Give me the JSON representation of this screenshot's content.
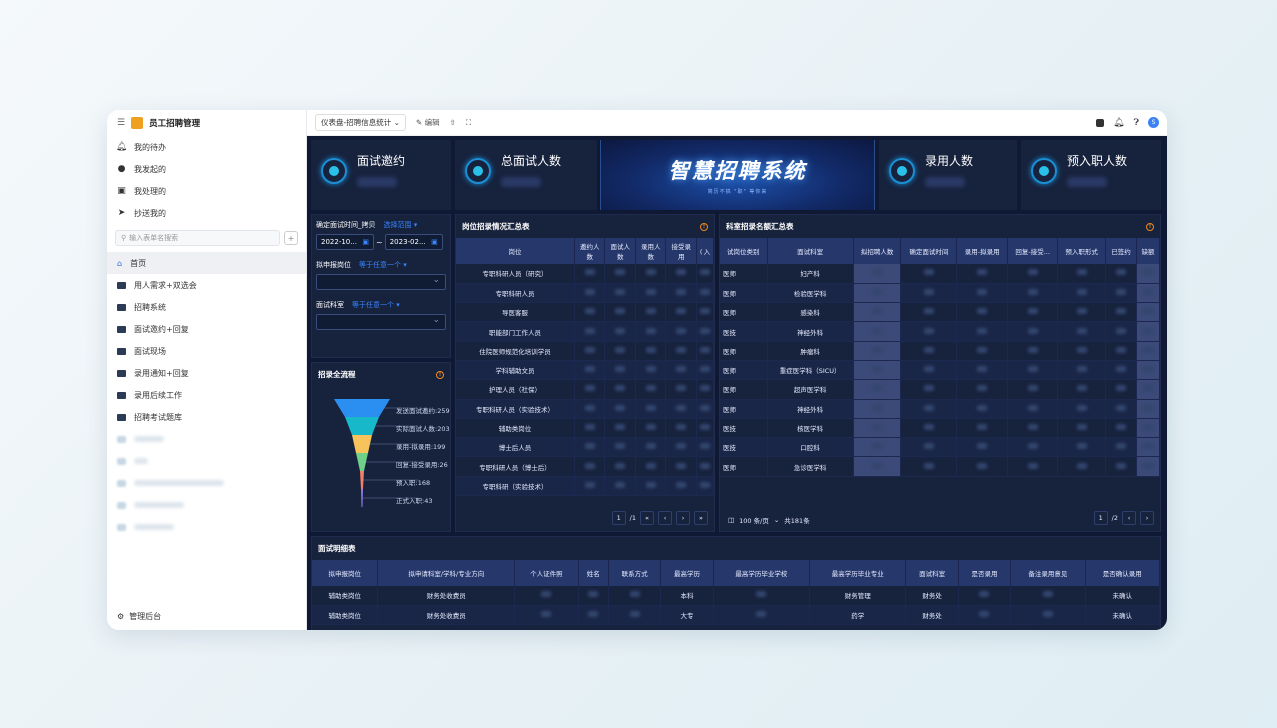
{
  "app": {
    "title": "员工招聘管理"
  },
  "sidebar": {
    "top_items": [
      {
        "label": "我的待办",
        "icon": "bell-icon"
      },
      {
        "label": "我发起的",
        "icon": "play-circle-icon"
      },
      {
        "label": "我处理的",
        "icon": "clipboard-icon"
      },
      {
        "label": "抄送我的",
        "icon": "send-icon"
      }
    ],
    "search_placeholder": "输入表单名搜索",
    "add_label": "+",
    "nav": [
      {
        "label": "首页",
        "active": true
      },
      {
        "label": "用人需求+双选会"
      },
      {
        "label": "招聘系统"
      },
      {
        "label": "面试邀约+回复"
      },
      {
        "label": "面试现场"
      },
      {
        "label": "录用通知+回复"
      },
      {
        "label": "录用后续工作"
      },
      {
        "label": "招聘考试题库"
      }
    ],
    "admin_label": "管理后台"
  },
  "toolbar": {
    "dashboard_select": "仪表盘-招聘信息统计",
    "edit_label": "编辑",
    "share_icon": "share-icon",
    "fullscreen_icon": "expand-icon",
    "avatar": "S"
  },
  "kpis": [
    {
      "title": "面试邀约"
    },
    {
      "title": "总面试人数"
    },
    {
      "title": "录用人数"
    },
    {
      "title": "预入职人数"
    }
  ],
  "banner": {
    "title": "智慧招聘系统",
    "subtitle": "简历不搞 \"职\" 等你来"
  },
  "filters": {
    "date_label": "确定面试时间_拷贝",
    "date_range_link": "选择范围",
    "date_start": "2022-10...",
    "date_sep": "~",
    "date_end": "2023-02...",
    "post_label": "拟申报岗位",
    "post_link": "等于任意一个",
    "dept_label": "面试科室",
    "dept_link": "等于任意一个"
  },
  "funnel": {
    "title": "招录全流程",
    "stages": [
      "发送面试邀约:259",
      "实际面试人数:203",
      "录用-拟录用:199",
      "回复-接受录用:26",
      "预入职:168",
      "正式入职:43"
    ]
  },
  "post_table": {
    "title": "岗位招录情况汇总表",
    "headers": [
      "岗位",
      "邀约人数",
      "面试人数",
      "录用人数",
      "接受录用",
      "( 入"
    ],
    "rows": [
      "专职科研人员（研究）",
      "专职科研人员",
      "导医客服",
      "职能部门工作人员",
      "住院医师规范化培训学员",
      "学科辅助文员",
      "护理人员（社保）",
      "专职科研人员（实验技术）",
      "辅助类岗位",
      "博士后人员",
      "专职科研人员（博士后）",
      "专职科研（实验技术）"
    ],
    "pager": {
      "current": "1",
      "total": "/1"
    }
  },
  "dept_table": {
    "title": "科室招录名额汇总表",
    "headers": [
      "试岗位类别",
      "面试科室",
      "拟招聘人数",
      "确定面试时间",
      "录用-拟录用",
      "回复-接受...",
      "预入职形式",
      "已签约",
      "缺额"
    ],
    "rows": [
      [
        "医师",
        "妇产科"
      ],
      [
        "医师",
        "检验医学科"
      ],
      [
        "医师",
        "感染科"
      ],
      [
        "医技",
        "神经外科"
      ],
      [
        "医师",
        "肿瘤科"
      ],
      [
        "医师",
        "重症医学科（SICU）"
      ],
      [
        "医师",
        "超声医学科"
      ],
      [
        "医师",
        "神经外科"
      ],
      [
        "医技",
        "核医学科"
      ],
      [
        "医技",
        "口腔科"
      ],
      [
        "医师",
        "急诊医学科"
      ]
    ],
    "page_size": "100 条/页",
    "total": "共181条",
    "pager": {
      "current": "1",
      "total": "/2"
    }
  },
  "detail_table": {
    "title": "面试明细表",
    "headers": [
      "拟申报岗位",
      "拟申请科室/学科/专业方向",
      "个人证件照",
      "姓名",
      "联系方式",
      "最高学历",
      "最高学历毕业学校",
      "最高学历毕业专业",
      "面试科室",
      "是否录用",
      "备注录用意见",
      "是否确认录用"
    ],
    "rows": [
      [
        "辅助类岗位",
        "财务处收费员",
        "",
        "",
        "",
        "本科",
        "",
        "财务管理",
        "财务处",
        "",
        "",
        "未确认"
      ],
      [
        "辅助类岗位",
        "财务处收费员",
        "",
        "",
        "",
        "大专",
        "",
        "药学",
        "财务处",
        "",
        "",
        "未确认"
      ]
    ]
  }
}
